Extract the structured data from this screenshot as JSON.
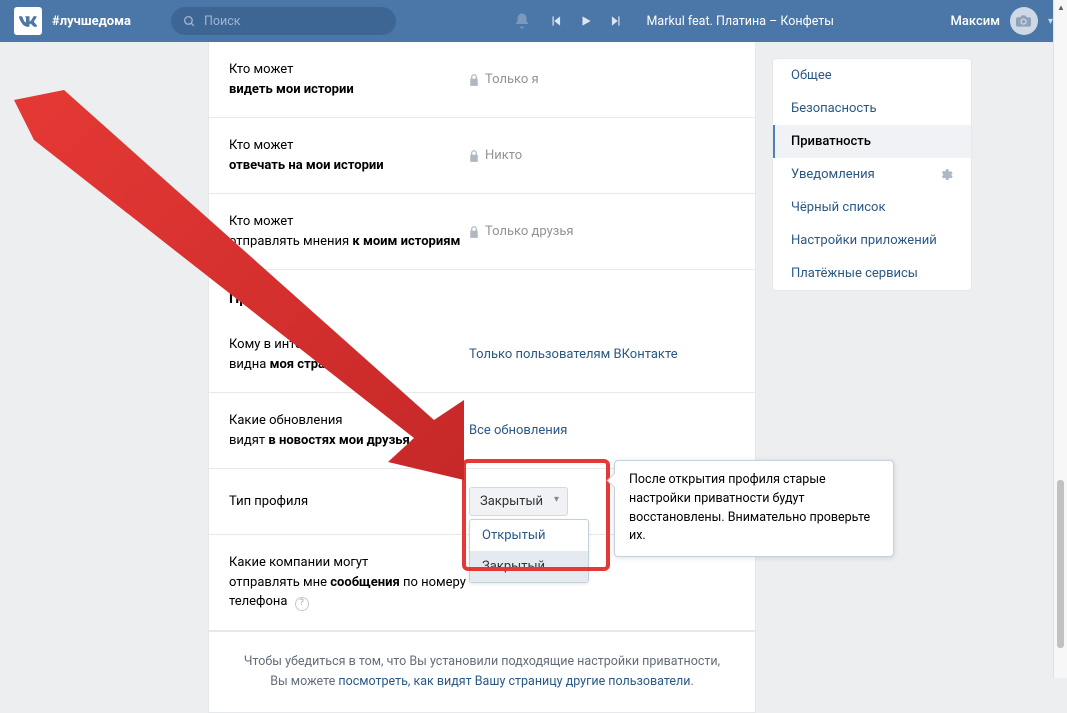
{
  "header": {
    "hashtag": "#лучшедома",
    "search_placeholder": "Поиск",
    "track": "Markul feat. Платина – Конфеты",
    "username": "Максим"
  },
  "settings": {
    "rows": [
      {
        "label1": "Кто может",
        "label2_bold": "видеть мои истории",
        "value": "Только я",
        "locked": true
      },
      {
        "label1": "Кто может",
        "label2_bold": "отвечать на мои истории",
        "value": "Никто",
        "locked": true
      },
      {
        "label1": "Кто может",
        "label2_prefix": "отправлять мнения ",
        "label2_bold": "к моим историям",
        "value": "Только друзья",
        "locked": true
      }
    ],
    "section_other": "Прочее",
    "other_rows": [
      {
        "label1": "Кому в интернете",
        "label2_prefix": "видна ",
        "label2_bold": "моя страница",
        "value": "Только пользователям ВКонтакте"
      },
      {
        "label1": "Какие обновления",
        "label2_prefix": "видят ",
        "label2_bold": "в новостях мои друзья",
        "value": "Все обновления"
      }
    ],
    "profile_type_label": "Тип профиля",
    "profile_type_value": "Закрытый",
    "profile_type_options": [
      "Открытый",
      "Закрытый"
    ],
    "companies_label1": "Какие компании могут",
    "companies_label2_prefix": "отправлять мне ",
    "companies_label2_bold": "сообщения",
    "companies_label2_suffix": " по номеру телефона",
    "tooltip": "После открытия профиля старые настройки приватности будут восстановлены. Внимательно проверьте их.",
    "footer_text1": "Чтобы убедиться в том, что Вы установили подходящие настройки приватности,",
    "footer_text2": "Вы можете ",
    "footer_link": "посмотреть, как видят Вашу страницу другие пользователи",
    "footer_dot": "."
  },
  "sidebar": {
    "items": [
      {
        "label": "Общее"
      },
      {
        "label": "Безопасность"
      },
      {
        "label": "Приватность",
        "active": true
      },
      {
        "label": "Уведомления",
        "gear": true
      },
      {
        "label": "Чёрный список"
      },
      {
        "label": "Настройки приложений"
      },
      {
        "label": "Платёжные сервисы"
      }
    ]
  }
}
